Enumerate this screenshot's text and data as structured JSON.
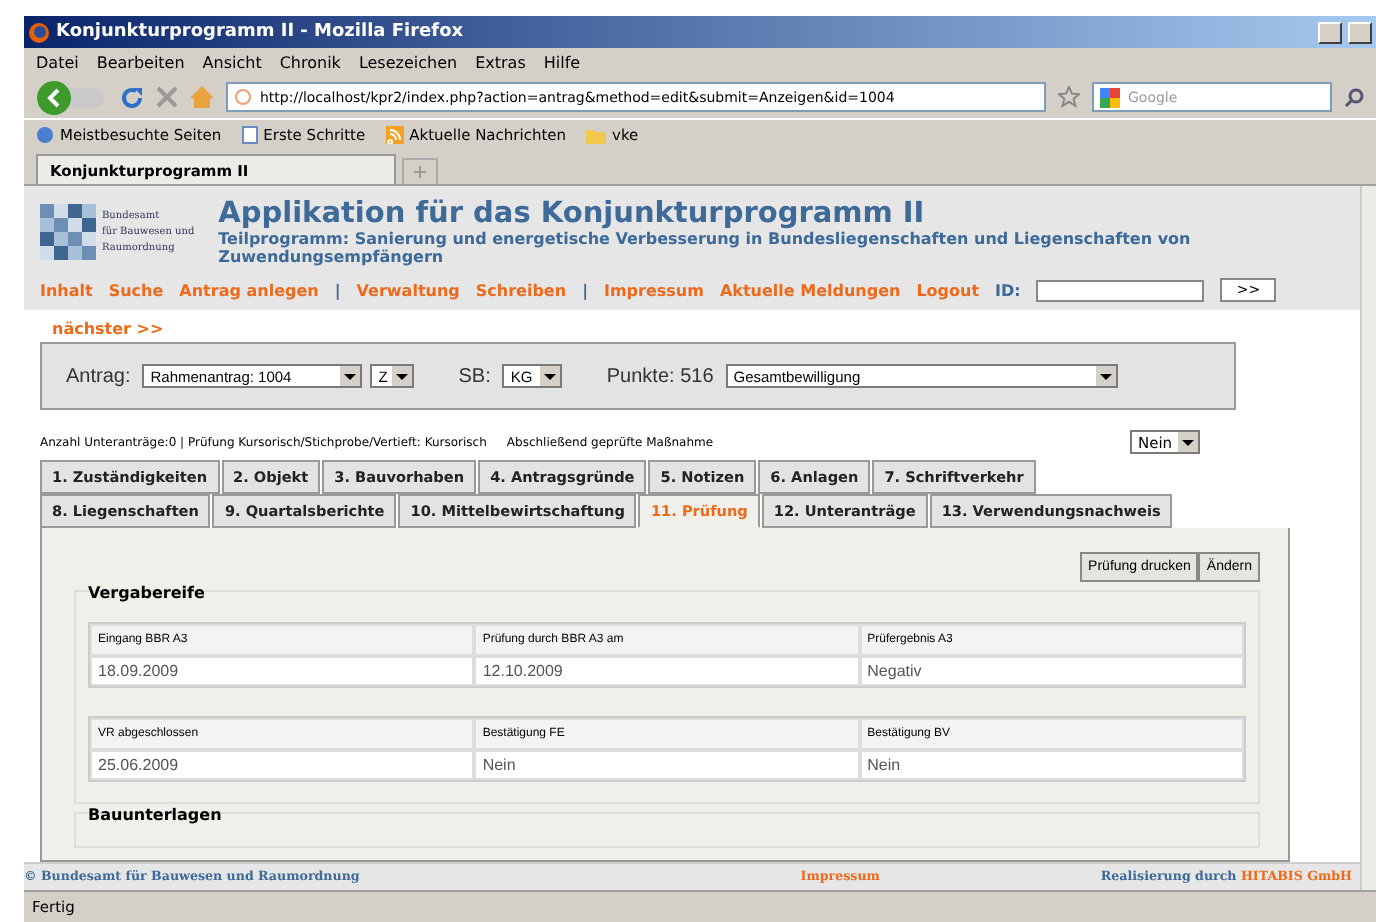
{
  "window": {
    "title": "Konjunkturprogramm II - Mozilla Firefox"
  },
  "menu": [
    "Datei",
    "Bearbeiten",
    "Ansicht",
    "Chronik",
    "Lesezeichen",
    "Extras",
    "Hilfe"
  ],
  "toolbar": {
    "url": "http://localhost/kpr2/index.php?action=antrag&method=edit&submit=Anzeigen&id=1004",
    "search_placeholder": "Google"
  },
  "bookmarks": [
    {
      "label": "Meistbesuchte Seiten",
      "kind": "globe"
    },
    {
      "label": "Erste Schritte",
      "kind": "page"
    },
    {
      "label": "Aktuelle Nachrichten",
      "kind": "feed"
    },
    {
      "label": "vke",
      "kind": "folder"
    }
  ],
  "browser_tabs": [
    {
      "label": "Konjunkturprogramm II",
      "selected": true
    }
  ],
  "page": {
    "org_lines": [
      "Bundesamt",
      "für Bauwesen und",
      "Raumordnung"
    ],
    "title": "Applikation für das Konjunkturprogramm II",
    "subtitle": "Teilprogramm: Sanierung und energetische Verbesserung in Bundesliegenschaften und Liegenschaften von Zuwendungsempfängern",
    "nav": [
      {
        "label": "Inhalt",
        "kind": "link"
      },
      {
        "label": "Suche",
        "kind": "link"
      },
      {
        "label": "Antrag anlegen",
        "kind": "link"
      },
      {
        "label": "|",
        "kind": "separator"
      },
      {
        "label": "Verwaltung",
        "kind": "link"
      },
      {
        "label": "Schreiben",
        "kind": "link"
      },
      {
        "label": "|",
        "kind": "separator"
      },
      {
        "label": "Impressum",
        "kind": "link"
      },
      {
        "label": "Aktuelle Meldungen",
        "kind": "link"
      },
      {
        "label": "Logout",
        "kind": "link"
      }
    ],
    "id_label": "ID:",
    "id_button": ">>",
    "next_link": "nächster >>",
    "filters": {
      "antrag_label": "Antrag:",
      "antrag_value": "Rahmenantrag: 1004",
      "type_value": "Z",
      "sb_label": "SB:",
      "sb_value": "KG",
      "points": "Punkte: 516",
      "approval": "Gesamtbewilligung"
    },
    "info": "Anzahl Unteranträge:0 | Prüfung Kursorisch/Stichprobe/Vertieft: Kursorisch",
    "final_label": "Abschließend geprüfte Maßnahme",
    "final_value": "Nein",
    "tab_rows": [
      [
        {
          "label": "1. Zuständigkeiten",
          "selected": false
        },
        {
          "label": "2. Objekt",
          "selected": false
        },
        {
          "label": "3. Bauvorhaben",
          "selected": false
        },
        {
          "label": "4. Antragsgründe",
          "selected": false
        },
        {
          "label": "5. Notizen",
          "selected": false
        },
        {
          "label": "6. Anlagen",
          "selected": false
        },
        {
          "label": "7. Schriftverkehr",
          "selected": false
        }
      ],
      [
        {
          "label": "8. Liegenschaften",
          "selected": false
        },
        {
          "label": "9. Quartalsberichte",
          "selected": false
        },
        {
          "label": "10. Mittelbewirtschaftung",
          "selected": false
        },
        {
          "label": "11. Prüfung",
          "selected": true
        },
        {
          "label": "12. Unteranträge",
          "selected": false
        },
        {
          "label": "13. Verwendungsnachweis",
          "selected": false
        }
      ]
    ],
    "buttons": [
      "Prüfung drucken",
      "Ändern"
    ],
    "sections": [
      {
        "legend": "Vergabereife",
        "tables": [
          {
            "headers": [
              "Eingang BBR A3",
              "Prüfung durch BBR A3 am",
              "Prüfergebnis A3"
            ],
            "values": [
              "18.09.2009",
              "12.10.2009",
              "Negativ"
            ]
          },
          {
            "headers": [
              "VR abgeschlossen",
              "Bestätigung FE",
              "Bestätigung BV"
            ],
            "values": [
              "25.06.2009",
              "Nein",
              "Nein"
            ]
          }
        ]
      },
      {
        "legend": "Bauunterlagen"
      }
    ],
    "footer": {
      "left": "© Bundesamt für Bauwesen und Raumordnung",
      "center": "Impressum",
      "right_prefix": "Realisierung durch",
      "right_brand": "HITABIS GmbH"
    }
  },
  "status": "Fertig"
}
